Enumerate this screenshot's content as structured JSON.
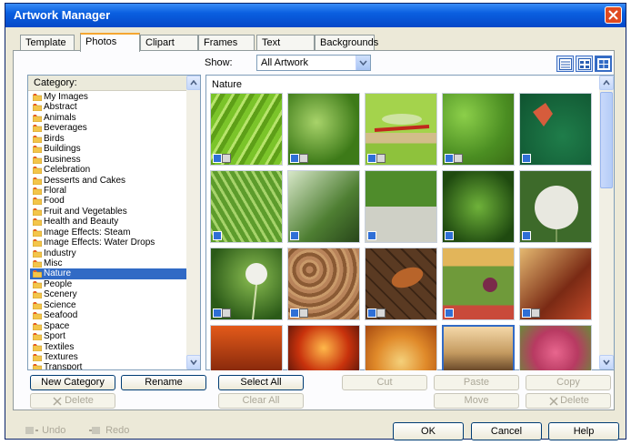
{
  "window": {
    "title": "Artwork Manager"
  },
  "tabs": [
    "Template",
    "Photos",
    "Clipart",
    "Frames",
    "Text Graphics",
    "Backgrounds"
  ],
  "show": {
    "label": "Show:",
    "value": "All Artwork"
  },
  "category": {
    "header": "Category:",
    "items": [
      "My Images",
      "Abstract",
      "Animals",
      "Beverages",
      "Birds",
      "Buildings",
      "Business",
      "Celebration",
      "Desserts and Cakes",
      "Floral",
      "Food",
      "Fruit and Vegetables",
      "Health and Beauty",
      "Image Effects: Steam",
      "Image Effects: Water Drops",
      "Industry",
      "Misc",
      "Nature",
      "People",
      "Scenery",
      "Science",
      "Seafood",
      "Space",
      "Sport",
      "Textiles",
      "Textures",
      "Transport"
    ],
    "selected": "Nature"
  },
  "gallery": {
    "title": "Nature"
  },
  "buttons": {
    "new_category": "New Category",
    "rename": "Rename",
    "delete": "Delete",
    "select_all": "Select All",
    "clear_all": "Clear All",
    "cut": "Cut",
    "paste": "Paste",
    "copy": "Copy",
    "move": "Move",
    "delete2": "Delete",
    "undo": "Undo",
    "redo": "Redo",
    "ok": "OK",
    "cancel": "Cancel",
    "help": "Help"
  }
}
